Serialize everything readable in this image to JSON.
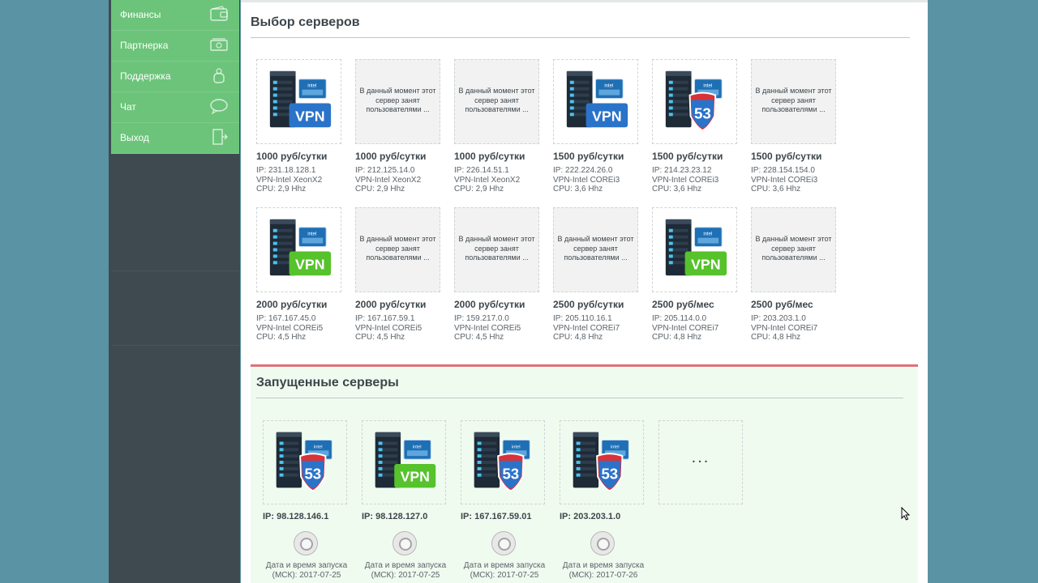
{
  "sidebar": {
    "items": [
      {
        "label": "Финансы",
        "icon": "wallet-icon"
      },
      {
        "label": "Партнерка",
        "icon": "money-icon"
      },
      {
        "label": "Поддержка",
        "icon": "support-icon"
      },
      {
        "label": "Чат",
        "icon": "chat-bubble-icon"
      },
      {
        "label": "Выход",
        "icon": "exit-door-icon"
      }
    ]
  },
  "servers_section": {
    "title": "Выбор серверов",
    "busy_text": "В данный момент этот сервер занят пользователями ...",
    "servers": [
      {
        "image": "server-xeon-vpn-blue",
        "busy": false,
        "price": "1000 руб/сутки",
        "ip": "IP: 231.18.128.1",
        "model": "VPN-Intel XeonX2",
        "cpu": "CPU: 2,9 Hhz"
      },
      {
        "image": "",
        "busy": true,
        "price": "1000 руб/сутки",
        "ip": "IP: 212.125.14.0",
        "model": "VPN-Intel XeonX2",
        "cpu": "CPU: 2,9 Hhz"
      },
      {
        "image": "",
        "busy": true,
        "price": "1000 руб/сутки",
        "ip": "IP: 226.14.51.1",
        "model": "VPN-Intel XeonX2",
        "cpu": "CPU: 2,9 Hhz"
      },
      {
        "image": "server-i3-vpn-blue",
        "busy": false,
        "price": "1500 руб/сутки",
        "ip": "IP: 222.224.26.0",
        "model": "VPN-Intel COREi3",
        "cpu": "CPU: 3,6 Hhz"
      },
      {
        "image": "server-i3-53-shield",
        "busy": false,
        "price": "1500 руб/сутки",
        "ip": "IP: 214.23.23.12",
        "model": "VPN-Intel COREi3",
        "cpu": "CPU: 3,6 Hhz"
      },
      {
        "image": "",
        "busy": true,
        "price": "1500 руб/сутки",
        "ip": "IP: 228.154.154.0",
        "model": "VPN-Intel COREi3",
        "cpu": "CPU: 3,6 Hhz"
      },
      {
        "image": "server-i5-vpn-green",
        "busy": false,
        "price": "2000 руб/сутки",
        "ip": "IP: 167.167.45.0",
        "model": "VPN-Intel COREi5",
        "cpu": "CPU: 4,5 Hhz"
      },
      {
        "image": "",
        "busy": true,
        "price": "2000 руб/сутки",
        "ip": "IP: 167.167.59.1",
        "model": "VPN-Intel COREi5",
        "cpu": "CPU: 4,5 Hhz"
      },
      {
        "image": "",
        "busy": true,
        "price": "2000 руб/сутки",
        "ip": "IP: 159.217.0.0",
        "model": "VPN-Intel COREi5",
        "cpu": "CPU: 4,5 Hhz"
      },
      {
        "image": "",
        "busy": true,
        "price": "2500 руб/сутки",
        "ip": "IP: 205.110.16.1",
        "model": "VPN-Intel COREi7",
        "cpu": "CPU: 4,8 Hhz"
      },
      {
        "image": "server-i7-vpn-green",
        "busy": false,
        "price": "2500 руб/мес",
        "ip": "IP: 205.114.0.0",
        "model": "VPN-Intel COREi7",
        "cpu": "CPU: 4,8 Hhz"
      },
      {
        "image": "",
        "busy": true,
        "price": "2500 руб/мес",
        "ip": "IP: 203.203.1.0",
        "model": "VPN-Intel COREi7",
        "cpu": "CPU: 4,8 Hhz"
      }
    ]
  },
  "running_section": {
    "title": "Запущенные серверы",
    "more_label": "...",
    "servers": [
      {
        "image": "server-53-shield",
        "ip": "IP: 98.128.146.1",
        "date": "Дата и время запуска (МСК): 2017-07-25"
      },
      {
        "image": "server-vpn-green",
        "ip": "IP: 98.128.127.0",
        "date": "Дата и время запуска (МСК): 2017-07-25"
      },
      {
        "image": "server-53-shield",
        "ip": "IP: 167.167.59.01",
        "date": "Дата и время запуска (МСК): 2017-07-25"
      },
      {
        "image": "server-53-shield",
        "ip": "IP: 203.203.1.0",
        "date": "Дата и время запуска (МСК): 2017-07-26"
      }
    ]
  },
  "colors": {
    "page_bg": "#5a93a3",
    "sidebar_bg": "#3f4a50",
    "menu_green": "#6cc47a",
    "running_bg": "#f0fbf0",
    "divider_red": "#e0707a",
    "vpn_blue": "#2a73c9",
    "vpn_green": "#56c22c",
    "shield_red": "#d8323a"
  }
}
